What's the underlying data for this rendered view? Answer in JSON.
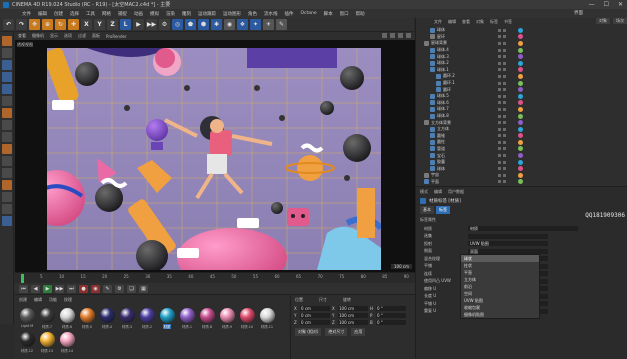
{
  "window": {
    "title": "CINEMA 4D R19.024 Studio (RC - R19) - [太空MAC2.c4d *] - 主要",
    "controls": [
      "—",
      "☐",
      "✕"
    ]
  },
  "menubar": {
    "items": [
      "文件",
      "编辑",
      "创建",
      "选择",
      "工具",
      "网格",
      "捕捉",
      "动画",
      "模拟",
      "渲染",
      "雕刻",
      "运动跟踪",
      "运动图形",
      "角色",
      "流水线",
      "插件",
      "Octane",
      "脚本",
      "窗口",
      "帮助"
    ],
    "right_label": "界面"
  },
  "toolbar": {
    "buttons": [
      "↶",
      "↷",
      "✥",
      "⊕",
      "↻",
      "✚",
      "X",
      "Y",
      "Z",
      "L",
      "▶",
      "▶▶",
      "⚙",
      "◎",
      "⬟",
      "⬢",
      "✱",
      "◉",
      "❖",
      "✦",
      "☀",
      "✎"
    ]
  },
  "viewport": {
    "menu": [
      "查看",
      "摄像机",
      "显示",
      "选项",
      "过滤",
      "面板",
      "ProRender"
    ],
    "label": "透视视图",
    "ticker": "100 cm"
  },
  "timeline": {
    "ticks": [
      "0",
      "5",
      "10",
      "15",
      "20",
      "25",
      "30",
      "35",
      "40",
      "45",
      "50",
      "55",
      "60",
      "65",
      "70",
      "75",
      "80",
      "85",
      "90"
    ],
    "current_frame": 0
  },
  "playbar": {
    "buttons": [
      "⏮",
      "◀",
      "▶",
      "▶▶",
      "⏭",
      "●",
      "◉",
      "✎",
      "⚙",
      "❏",
      "▦"
    ]
  },
  "materials": {
    "menu": [
      "创建",
      "编辑",
      "功能",
      "纹理"
    ],
    "items": [
      {
        "label": "Light M",
        "color": "#5a5a5a"
      },
      {
        "label": "材质.7",
        "color": "#3a3a3a"
      },
      {
        "label": "材质.6",
        "color": "#d8d8d8"
      },
      {
        "label": "材质.5",
        "color": "#e07a2a"
      },
      {
        "label": "材质.4",
        "color": "#2b2b6b"
      },
      {
        "label": "材质.3",
        "color": "#3a2c6e"
      },
      {
        "label": "材质.2",
        "color": "#4a3da0"
      },
      {
        "label": "材质",
        "color": "#1ea0c8",
        "selected": true
      },
      {
        "label": "材质.1",
        "color": "#8e5ec9"
      },
      {
        "label": "材质.8",
        "color": "#c74b8c"
      },
      {
        "label": "材质.9",
        "color": "#e88ab0"
      },
      {
        "label": "材质.10",
        "color": "#e04a6c"
      },
      {
        "label": "材质.11",
        "color": "#d9d9d9"
      },
      {
        "label": "材质.12",
        "color": "#2a2a2a"
      },
      {
        "label": "材质.13",
        "color": "#f0b030"
      },
      {
        "label": "材质.14",
        "color": "#f4a4c0"
      }
    ]
  },
  "coords": {
    "headers": [
      "位置",
      "尺寸",
      "旋转"
    ],
    "rows": [
      {
        "axis": "X",
        "pos": "0 cm",
        "size": "100 cm",
        "rot_axis": "H",
        "rot": "0 °"
      },
      {
        "axis": "Y",
        "pos": "0 cm",
        "size": "100 cm",
        "rot_axis": "P",
        "rot": "0 °"
      },
      {
        "axis": "Z",
        "pos": "0 cm",
        "size": "100 cm",
        "rot_axis": "B",
        "rot": "0 °"
      }
    ],
    "mode": "对象 (相对)",
    "size_mode": "绝对尺寸",
    "apply": "应用"
  },
  "object_manager": {
    "menu": [
      "文件",
      "编辑",
      "查看",
      "对象",
      "标签",
      "书签"
    ],
    "tabs": [
      "对象",
      "场次"
    ],
    "rows": [
      {
        "name": "球体",
        "indent": 2,
        "type": "geo"
      },
      {
        "name": "星环",
        "indent": 2,
        "type": "null"
      },
      {
        "name": "星球背景",
        "indent": 1,
        "type": "null"
      },
      {
        "name": "球体.4",
        "indent": 2,
        "type": "geo"
      },
      {
        "name": "球体.3",
        "indent": 2,
        "type": "geo"
      },
      {
        "name": "球体.2",
        "indent": 2,
        "type": "geo"
      },
      {
        "name": "球体.1",
        "indent": 2,
        "type": "geo"
      },
      {
        "name": "圆环.2",
        "indent": 3,
        "type": "geo"
      },
      {
        "name": "圆环.1",
        "indent": 3,
        "type": "geo"
      },
      {
        "name": "圆环",
        "indent": 3,
        "type": "geo"
      },
      {
        "name": "球体.5",
        "indent": 2,
        "type": "geo"
      },
      {
        "name": "球体.6",
        "indent": 2,
        "type": "geo"
      },
      {
        "name": "球体.7",
        "indent": 2,
        "type": "geo"
      },
      {
        "name": "球体.8",
        "indent": 2,
        "type": "geo"
      },
      {
        "name": "立方体背景",
        "indent": 1,
        "type": "null"
      },
      {
        "name": "立方体",
        "indent": 2,
        "type": "geo"
      },
      {
        "name": "圆锥",
        "indent": 2,
        "type": "geo"
      },
      {
        "name": "圆柱",
        "indent": 2,
        "type": "geo"
      },
      {
        "name": "管道",
        "indent": 2,
        "type": "geo"
      },
      {
        "name": "宝石",
        "indent": 2,
        "type": "geo"
      },
      {
        "name": "胶囊",
        "indent": 2,
        "type": "geo"
      },
      {
        "name": "球体",
        "indent": 2,
        "type": "geo"
      },
      {
        "name": "宇宙",
        "indent": 1,
        "type": "null"
      },
      {
        "name": "平面",
        "indent": 1,
        "type": "geo"
      }
    ]
  },
  "attributes": {
    "menu": [
      "模式",
      "编辑",
      "用户数据"
    ],
    "object_name": "材质标签 [材质]",
    "tabs": [
      "基本",
      "标签"
    ],
    "section": "标签属性",
    "watermark": "QQ181909306",
    "rows": [
      {
        "label": "材质",
        "value": "材质"
      },
      {
        "label": "选集",
        "value": ""
      },
      {
        "label": "投射",
        "value": "UVW 贴图"
      },
      {
        "label": "侧面",
        "value": "双面"
      },
      {
        "label": "混合纹理",
        "value": ""
      },
      {
        "label": "平铺",
        "value": "✓"
      },
      {
        "label": "连续",
        "value": ""
      },
      {
        "label": "使用凹凸 UVW",
        "value": ""
      },
      {
        "label": "偏移 U",
        "value": "0 %"
      },
      {
        "label": "长度 U",
        "value": "100 %"
      },
      {
        "label": "平铺 U",
        "value": "1"
      },
      {
        "label": "重复 U",
        "value": "0"
      }
    ],
    "dropdown_options": [
      "球状",
      "柱状",
      "平直",
      "立方体",
      "前沿",
      "空间",
      "UVW 贴图",
      "收缩包裹",
      "摄像机贴图"
    ],
    "dropdown_highlight": 0
  }
}
